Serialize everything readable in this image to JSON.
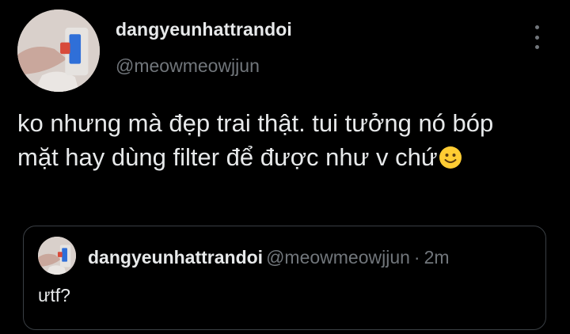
{
  "tweet": {
    "display_name": "dangyeunhattrandoi",
    "handle": "@meowmeowjjun",
    "text": "ko nhưng mà đẹp trai thật. tui tưởng nó bóp mặt hay dùng filter để được như v chứ",
    "emoji": "slightly-smiling-face",
    "more_icon": "more-vertical-icon"
  },
  "quote": {
    "display_name": "dangyeunhattrandoi",
    "handle": "@meowmeowjjun",
    "separator": "·",
    "time": "2m",
    "text": "ưtf?"
  },
  "colors": {
    "background": "#000000",
    "primary_text": "#e7e9ea",
    "secondary_text": "#71767b",
    "border": "#3a3f44",
    "emoji": "#ffcc33"
  }
}
